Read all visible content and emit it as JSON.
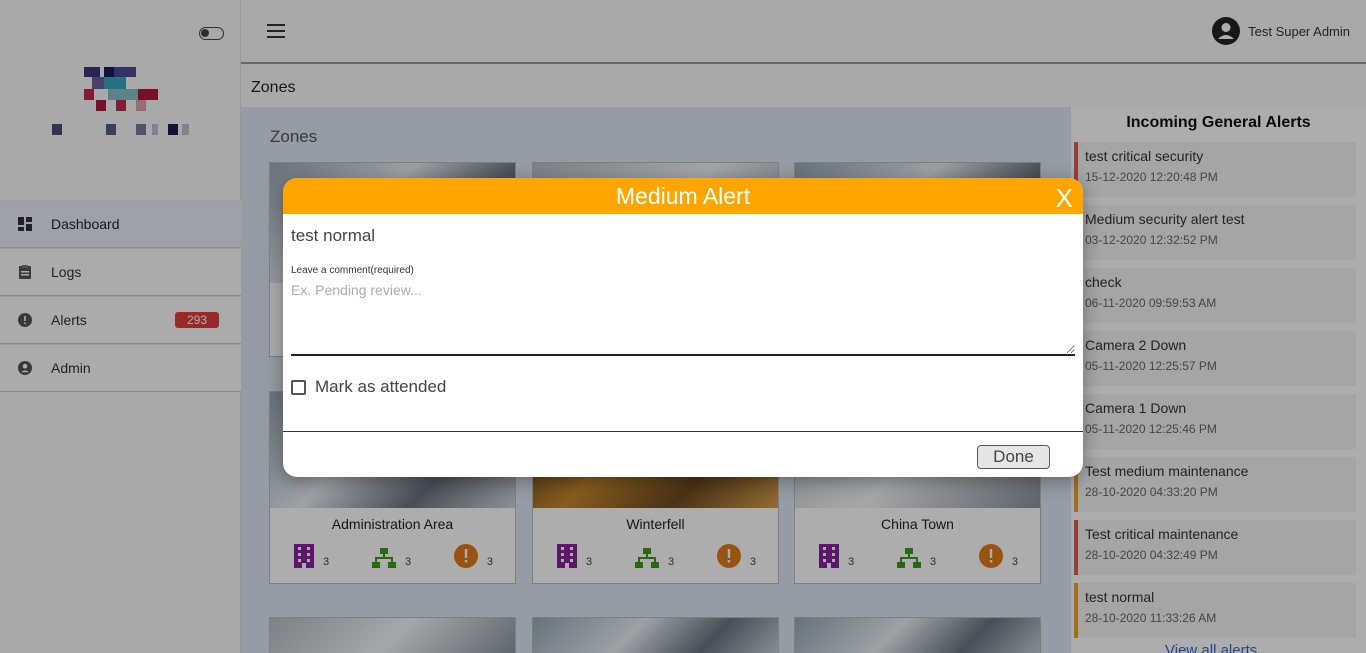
{
  "header": {
    "user_name": "Test Super Admin"
  },
  "breadcrumb": "Zones",
  "sidebar": {
    "items": [
      {
        "label": "Dashboard",
        "icon": "dashboard-icon"
      },
      {
        "label": "Logs",
        "icon": "clipboard-icon"
      },
      {
        "label": "Alerts",
        "icon": "alert-circle-icon",
        "badge": "293"
      },
      {
        "label": "Admin",
        "icon": "account-circle-icon"
      }
    ]
  },
  "main": {
    "title": "Zones",
    "cards": [
      {
        "name": "Administration Area",
        "buildings": "3",
        "networks": "3",
        "alerts": "3"
      },
      {
        "name": "Winterfell",
        "buildings": "3",
        "networks": "3",
        "alerts": "3"
      },
      {
        "name": "China Town",
        "buildings": "3",
        "networks": "3",
        "alerts": "3"
      }
    ]
  },
  "alerts_panel": {
    "title": "Incoming General Alerts",
    "items": [
      {
        "title": "test critical security",
        "date": "15-12-2020 12:20:48 PM",
        "severity": "critical"
      },
      {
        "title": "Medium security alert test",
        "date": "03-12-2020 12:32:52 PM",
        "severity": "none"
      },
      {
        "title": "check",
        "date": "06-11-2020 09:59:53 AM",
        "severity": "none"
      },
      {
        "title": "Camera 2 Down",
        "date": "05-11-2020 12:25:57 PM",
        "severity": "none"
      },
      {
        "title": "Camera 1 Down",
        "date": "05-11-2020 12:25:46 PM",
        "severity": "none"
      },
      {
        "title": "Test medium maintenance",
        "date": "28-10-2020 04:33:20 PM",
        "severity": "medium"
      },
      {
        "title": "Test critical maintenance",
        "date": "28-10-2020 04:32:49 PM",
        "severity": "critical"
      },
      {
        "title": "test normal",
        "date": "28-10-2020 11:33:26 AM",
        "severity": "medium"
      }
    ],
    "view_all": "View all alerts"
  },
  "modal": {
    "title": "Medium Alert",
    "close_label": "X",
    "alert_name": "test normal",
    "comment_label": "Leave a comment(required)",
    "comment_placeholder": "Ex. Pending review...",
    "comment_value": "",
    "checkbox_label": "Mark as attended",
    "checkbox_checked": false,
    "done_label": "Done",
    "header_color": "#ffa500"
  },
  "colors": {
    "accent": "#ffa500",
    "badge": "#e23b3b",
    "critical": "#e05a5a",
    "medium": "#f0a030",
    "link": "#2a6fd6"
  }
}
